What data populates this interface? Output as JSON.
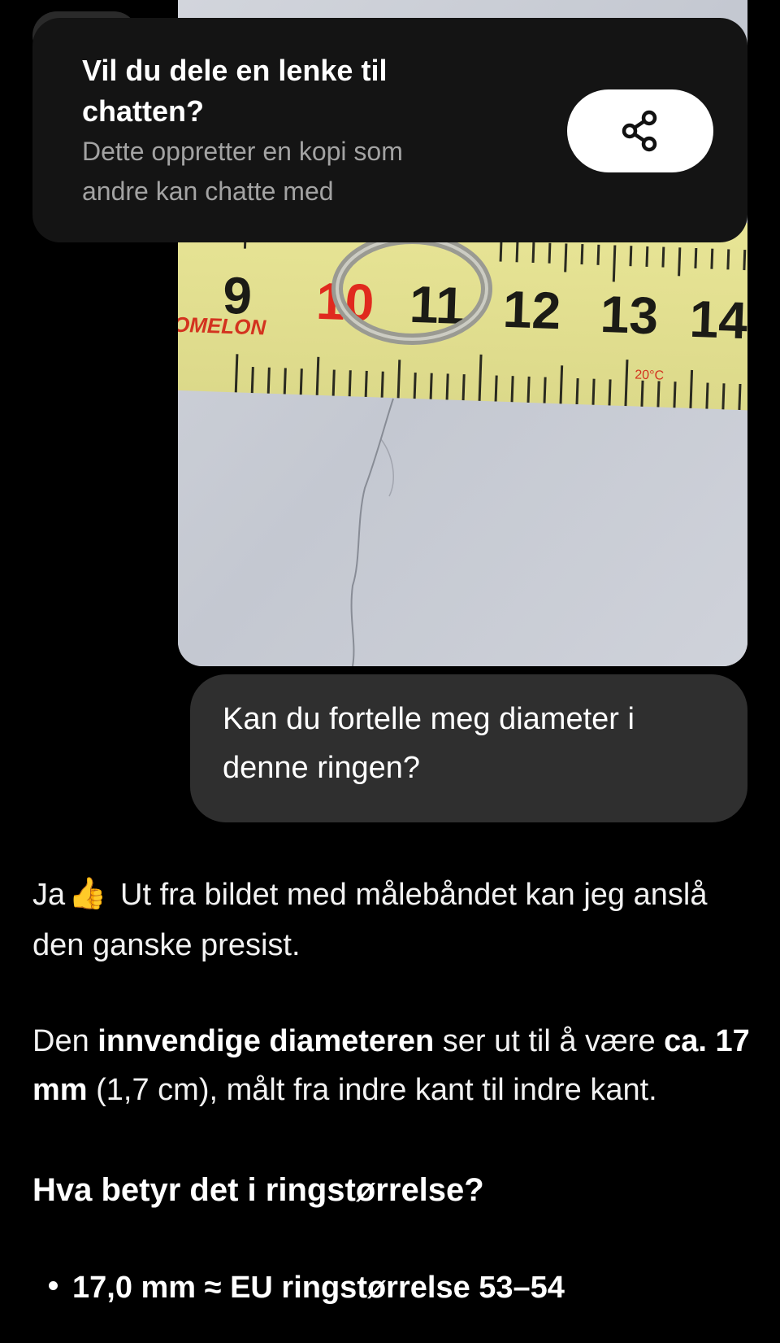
{
  "share_banner": {
    "title": "Vil du dele en lenke til chatten?",
    "subtitle": "Dette oppretter en kopi som andre kan chatte med",
    "share_icon": "share-icon"
  },
  "photo": {
    "brand": "OMELON",
    "temp_mark": "20°C",
    "tape_numbers": [
      "9",
      "10",
      "11",
      "12",
      "13",
      "14"
    ]
  },
  "user_message": "Kan du fortelle meg diameter i denne ringen?",
  "assistant": {
    "p1_start": "Ja",
    "p1_emoji": "👍",
    "p1_rest": "Ut fra bildet med målebåndet kan jeg anslå den ganske presist.",
    "p2_a": "Den ",
    "p2_bold1": "innvendige diameteren",
    "p2_b": " ser ut til å være ",
    "p2_bold2": "ca. 17 mm",
    "p2_c": " (1,7 cm), målt fra indre kant til indre kant.",
    "heading": "Hva betyr det i ringstørrelse?",
    "bullets": [
      "17,0 mm ≈ EU ringstørrelse 53–54"
    ]
  }
}
